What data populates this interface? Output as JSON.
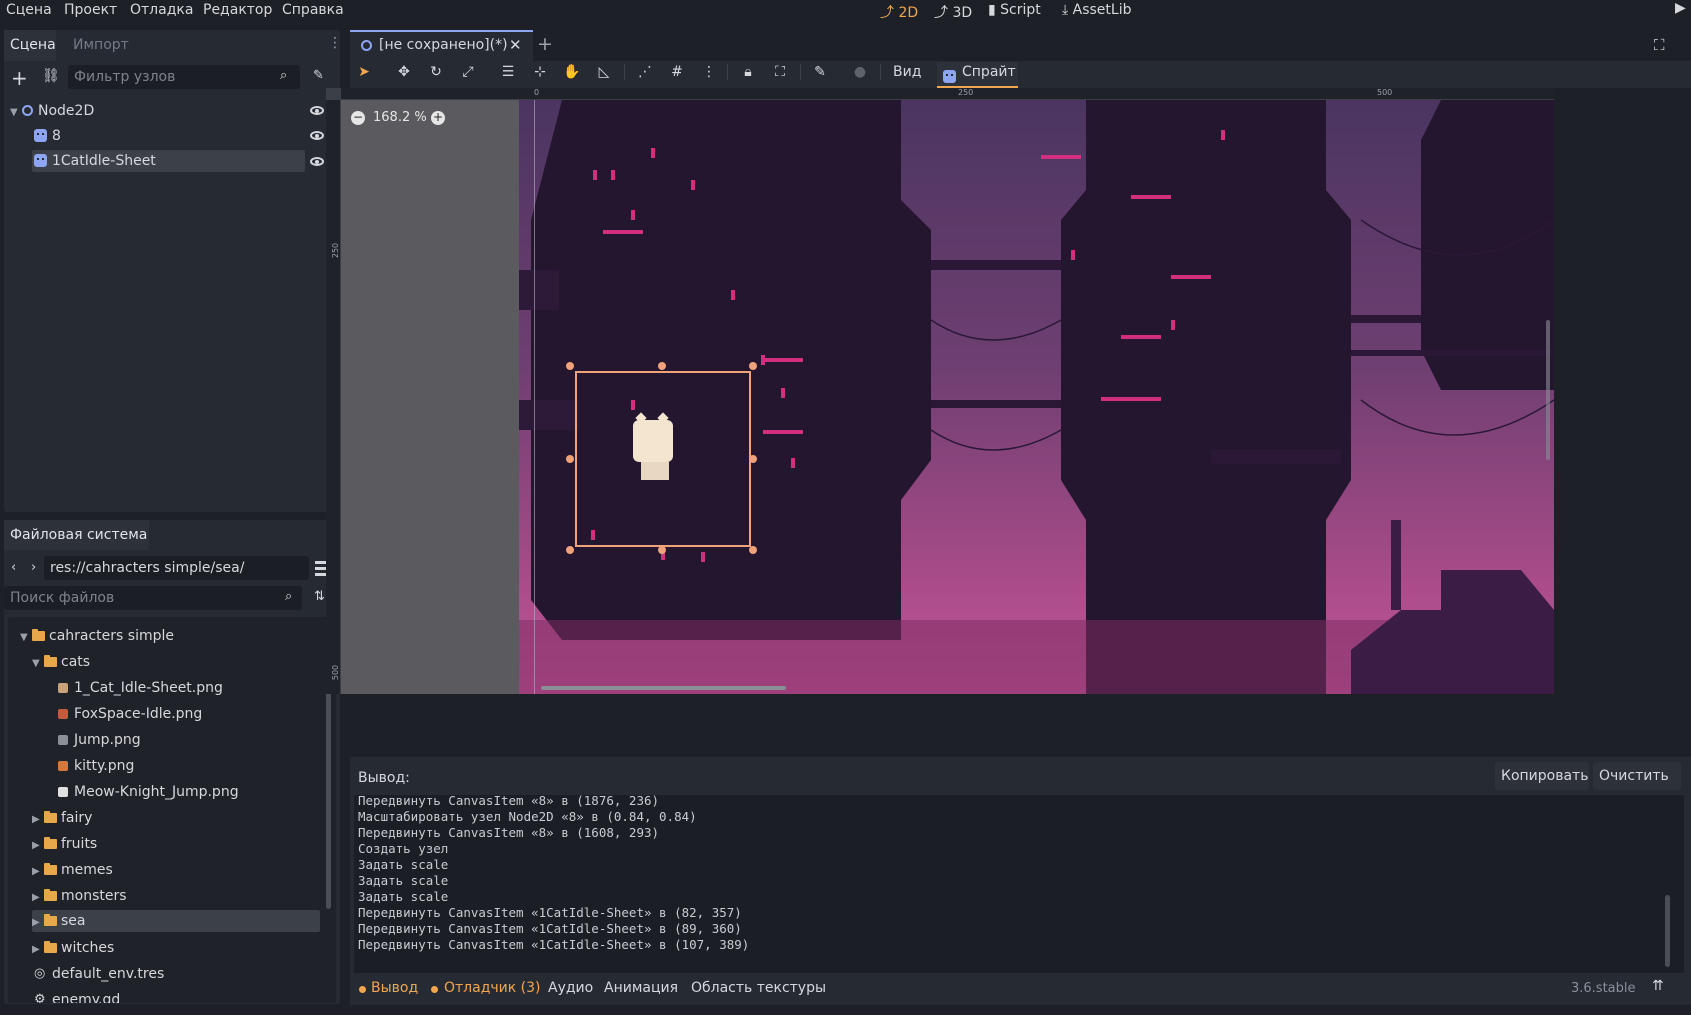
{
  "menu": [
    "Сцена",
    "Проект",
    "Отладка",
    "Редактор",
    "Справка"
  ],
  "modes": [
    {
      "label": "2D",
      "icon": "2d-icon",
      "active": true
    },
    {
      "label": "3D",
      "icon": "3d-icon",
      "active": false
    },
    {
      "label": "Script",
      "icon": "script-icon",
      "active": false
    },
    {
      "label": "AssetLib",
      "icon": "assetlib-icon",
      "active": false
    }
  ],
  "scene_dock": {
    "tabs": [
      "Сцена",
      "Импорт"
    ],
    "filter_placeholder": "Фильтр узлов",
    "tree": [
      {
        "label": "Node2D",
        "icon": "node2d-icon",
        "depth": 0,
        "selected": false
      },
      {
        "label": "8",
        "icon": "sprite2d-icon",
        "depth": 1,
        "selected": false
      },
      {
        "label": "1CatIdle-Sheet",
        "icon": "sprite2d-icon",
        "depth": 1,
        "selected": true
      }
    ]
  },
  "filesystem": {
    "title": "Файловая система",
    "path": "res://cahracters simple/sea/",
    "search_placeholder": "Поиск файлов",
    "items": [
      {
        "label": "cahracters simple",
        "type": "folder",
        "depth": 0,
        "expanded": true
      },
      {
        "label": "cats",
        "type": "folder",
        "depth": 1,
        "expanded": true
      },
      {
        "label": "1_Cat_Idle-Sheet.png",
        "type": "file",
        "depth": 2
      },
      {
        "label": "FoxSpace-Idle.png",
        "type": "file",
        "depth": 2
      },
      {
        "label": "Jump.png",
        "type": "file",
        "depth": 2
      },
      {
        "label": "kitty.png",
        "type": "file",
        "depth": 2
      },
      {
        "label": "Meow-Knight_Jump.png",
        "type": "file",
        "depth": 2
      },
      {
        "label": "fairy",
        "type": "folder",
        "depth": 1,
        "expanded": false
      },
      {
        "label": "fruits",
        "type": "folder",
        "depth": 1,
        "expanded": false
      },
      {
        "label": "memes",
        "type": "folder",
        "depth": 1,
        "expanded": false
      },
      {
        "label": "monsters",
        "type": "folder",
        "depth": 1,
        "expanded": false
      },
      {
        "label": "sea",
        "type": "folder",
        "depth": 1,
        "expanded": false,
        "selected": true
      },
      {
        "label": "witches",
        "type": "folder",
        "depth": 1,
        "expanded": false
      },
      {
        "label": "default_env.tres",
        "type": "resource",
        "depth": 0
      },
      {
        "label": "enemy.gd",
        "type": "script",
        "depth": 0
      }
    ]
  },
  "editor": {
    "tab_title": "[не сохранено](*)",
    "toolbar_view": "Вид",
    "toolbar_sprite": "Спрайт",
    "zoom": "168.2 %",
    "ruler_h": [
      "0",
      "250",
      "500"
    ],
    "ruler_v": [
      "250",
      "500"
    ]
  },
  "output": {
    "title": "Вывод:",
    "copy_label": "Копировать",
    "clear_label": "Очистить",
    "lines": [
      "Передвинуть CanvasItem «8» в (1876, 236)",
      "Масштабировать узел Node2D «8» в (0.84, 0.84)",
      "Передвинуть CanvasItem «8» в (1608, 293)",
      "Создать узел",
      "Задать scale",
      "Задать scale",
      "Задать scale",
      "Передвинуть CanvasItem «1CatIdle-Sheet» в (82, 357)",
      "Передвинуть CanvasItem «1CatIdle-Sheet» в (89, 360)",
      "Передвинуть CanvasItem «1CatIdle-Sheet» в (107, 389)"
    ]
  },
  "bottom_tabs": [
    "Вывод",
    "Отладчик (3)",
    "Аудио",
    "Анимация",
    "Область текстуры"
  ],
  "version": "3.6.stable",
  "colors": {
    "accent": "#f0a74f",
    "node_icon": "#8da5f3",
    "folder": "#e6a84a"
  }
}
